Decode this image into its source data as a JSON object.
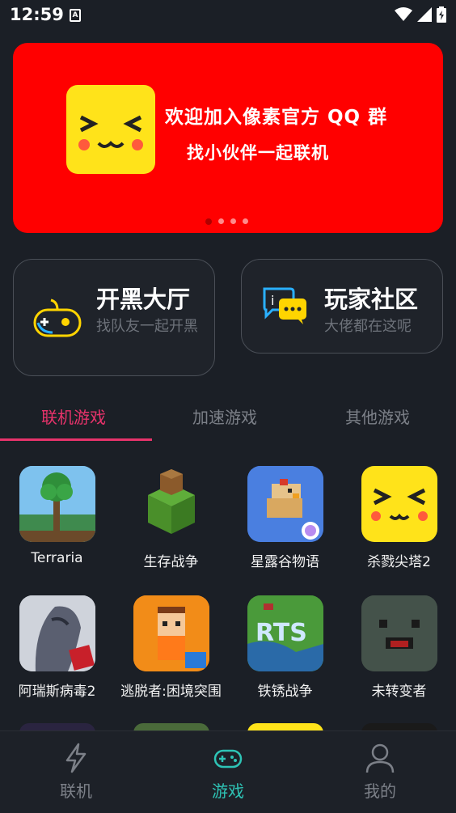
{
  "status_bar": {
    "time": "12:59",
    "notification_icon": "a-app-icon",
    "icons": [
      "wifi-icon",
      "signal-icon",
      "battery-charging-icon"
    ]
  },
  "banner": {
    "line1": "欢迎加入像素官方 QQ 群",
    "line2": "找小伙伴一起联机",
    "dots": 4,
    "active_dot": 0,
    "background": "#ff0000"
  },
  "cards": [
    {
      "title": "开黑大厅",
      "subtitle": "找队友一起开黑",
      "icon": "gamepad-icon"
    },
    {
      "title": "玩家社区",
      "subtitle": "大佬都在这呢",
      "icon": "chat-bubbles-icon"
    }
  ],
  "tabs": [
    {
      "label": "联机游戏",
      "active": true
    },
    {
      "label": "加速游戏",
      "active": false
    },
    {
      "label": "其他游戏",
      "active": false
    }
  ],
  "games": [
    {
      "name": "Terraria",
      "icon": "terraria-icon"
    },
    {
      "name": "生存战争",
      "icon": "survivalcraft-icon"
    },
    {
      "name": "星露谷物语",
      "icon": "stardew-chicken-icon"
    },
    {
      "name": "杀戮尖塔2",
      "icon": "yellow-face-icon"
    },
    {
      "name": "阿瑞斯病毒2",
      "icon": "ares-virus-icon"
    },
    {
      "name": "逃脱者:困境突围",
      "icon": "escapists-icon"
    },
    {
      "name": "铁锈战争",
      "icon": "rusted-warfare-icon"
    },
    {
      "name": "未转变者",
      "icon": "unturned-icon"
    }
  ],
  "bottom_nav": [
    {
      "label": "联机",
      "icon": "lightning-icon",
      "active": false
    },
    {
      "label": "游戏",
      "icon": "gamepad-nav-icon",
      "active": true
    },
    {
      "label": "我的",
      "icon": "user-icon",
      "active": false
    }
  ],
  "colors": {
    "accent": "#e8336b",
    "nav_active": "#2ec4b6",
    "background": "#1b1f26"
  }
}
